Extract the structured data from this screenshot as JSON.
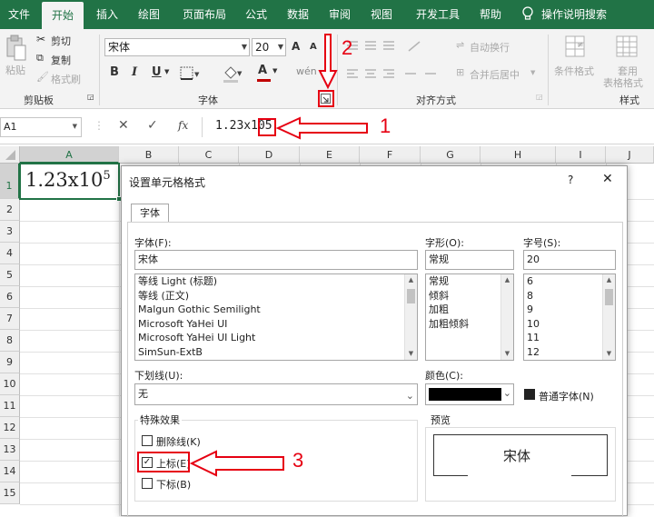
{
  "tabs": [
    "文件",
    "开始",
    "插入",
    "绘图",
    "页面布局",
    "公式",
    "数据",
    "审阅",
    "视图",
    "开发工具",
    "帮助",
    "操作说明搜索"
  ],
  "ribbon": {
    "clipboard": {
      "paste": "粘贴",
      "cut": "剪切",
      "copy": "复制",
      "format_painter": "格式刷",
      "label": "剪贴板"
    },
    "font": {
      "font_name": "宋体",
      "font_size": "20",
      "grow": "A",
      "shrink": "A",
      "bold": "B",
      "italic": "I",
      "underline": "U",
      "font_color": "A",
      "label": "字体"
    },
    "alignment": {
      "wrap_text": "自动换行",
      "merge_center": "合并后居中",
      "label": "对齐方式"
    },
    "styles": {
      "conditional": "条件格式",
      "table_format_1": "套用",
      "table_format_2": "表格格式",
      "label": "样式"
    }
  },
  "formula_bar": {
    "name_box": "A1",
    "cancel": "✕",
    "enter": "✓",
    "fx": "fx",
    "value": "1.23x105"
  },
  "sheet": {
    "columns": [
      "A",
      "B",
      "C",
      "D",
      "E",
      "F",
      "G",
      "H",
      "I",
      "J"
    ],
    "rows": [
      "1",
      "2",
      "3",
      "4",
      "5",
      "6",
      "7",
      "8",
      "9",
      "10",
      "11",
      "12",
      "13",
      "14",
      "15"
    ],
    "a1_base": "1.23x10",
    "a1_sup": "5"
  },
  "dialog": {
    "title": "设置单元格格式",
    "help": "?",
    "close": "✕",
    "tab": "字体",
    "font_label": "字体(F):",
    "font_value": "宋体",
    "font_list": [
      "等线 Light (标题)",
      "等线 (正文)",
      "Malgun Gothic Semilight",
      "Microsoft YaHei UI",
      "Microsoft YaHei UI Light",
      "SimSun-ExtB"
    ],
    "style_label": "字形(O):",
    "style_value": "常规",
    "style_list": [
      "常规",
      "倾斜",
      "加粗",
      "加粗倾斜"
    ],
    "size_label": "字号(S):",
    "size_value": "20",
    "size_list": [
      "6",
      "8",
      "9",
      "10",
      "11",
      "12"
    ],
    "underline_label": "下划线(U):",
    "underline_value": "无",
    "color_label": "颜色(C):",
    "color_value": "#000000",
    "normal_font": "普通字体(N)",
    "effects_label": "特殊效果",
    "strikethrough": "删除线(K)",
    "superscript": "上标(E)",
    "subscript": "下标(B)",
    "preview_label": "预览",
    "preview_text": "宋体"
  },
  "annotations": [
    "1",
    "2",
    "3"
  ],
  "colors": {
    "excel_green": "#217346",
    "annotation_red": "#e60012"
  }
}
